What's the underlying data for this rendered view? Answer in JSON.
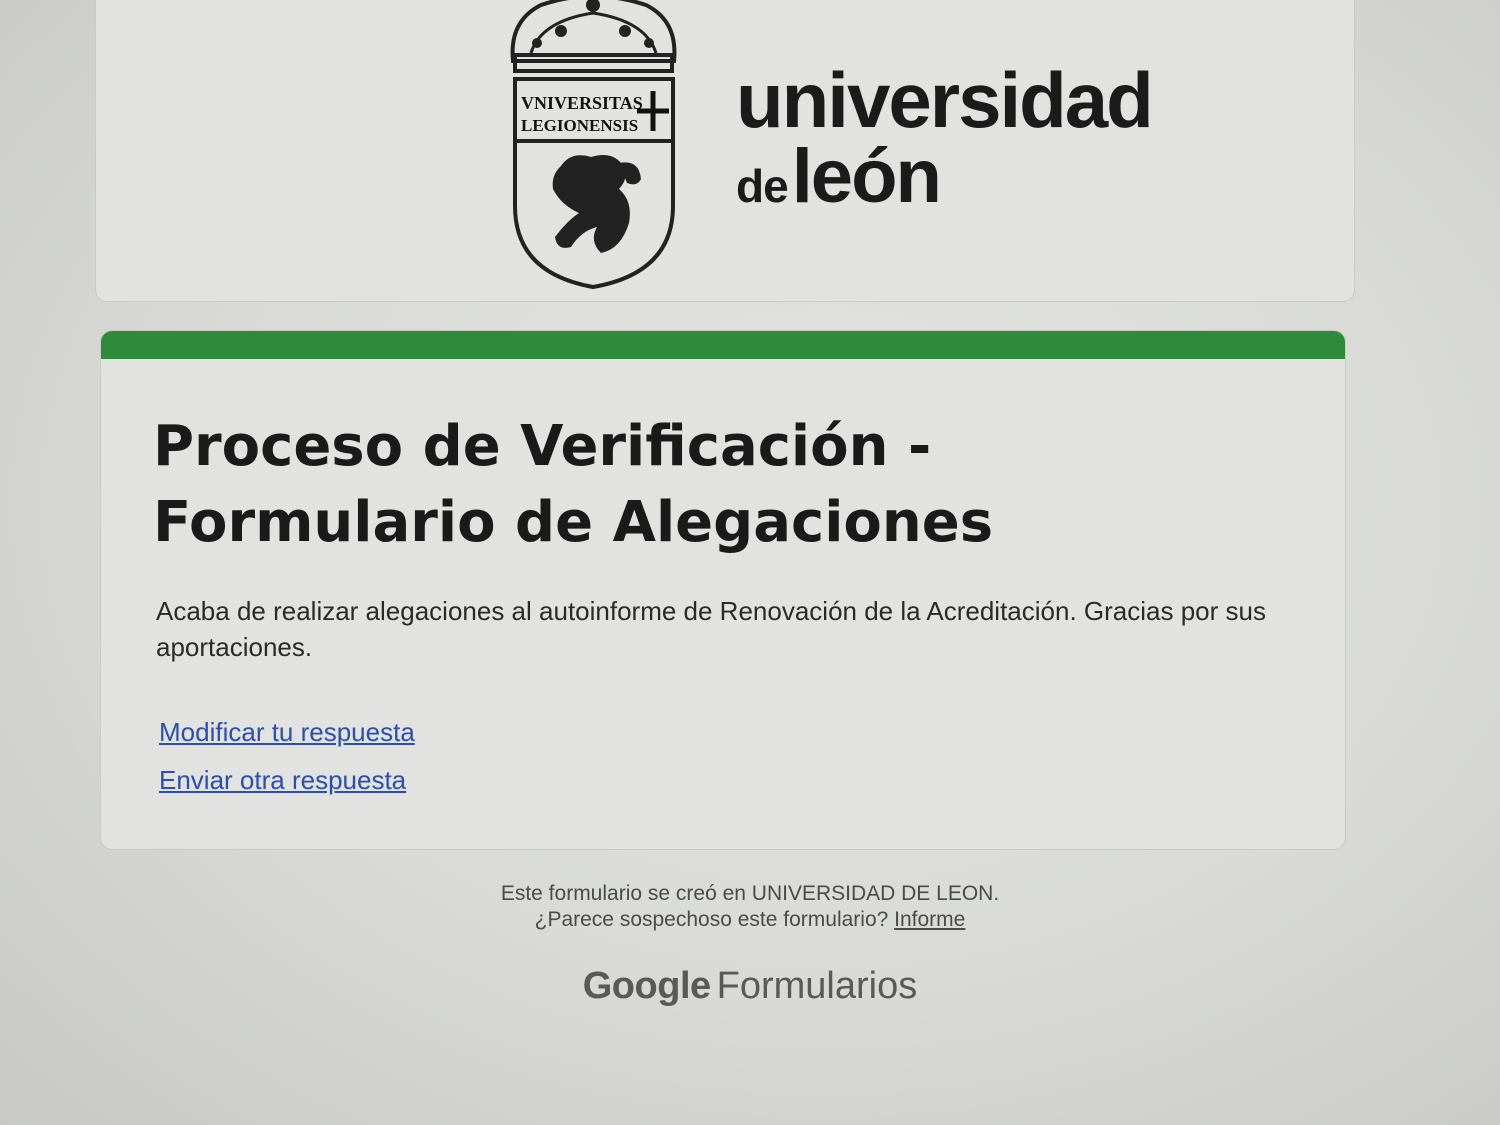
{
  "header": {
    "crest_motto_line1": "VNIVERSITAS",
    "crest_motto_line2": "LEGIONENSIS",
    "brand_line1": "universidad",
    "brand_line2_de": "de",
    "brand_line2_leon": "león"
  },
  "form": {
    "accent_color": "#2e8b3a",
    "title": "Proceso de Verificación - Formulario de Alegaciones",
    "description": "Acaba de realizar alegaciones al autoinforme de Renovación de la Acreditación. Gracias por sus aportaciones.",
    "links": {
      "edit_response": "Modificar tu respuesta",
      "submit_another": "Enviar otra respuesta"
    }
  },
  "footer": {
    "created_in": "Este formulario se creó en UNIVERSIDAD DE LEON.",
    "suspicious_question": "¿Parece sospechoso este formulario?",
    "report_link": "Informe",
    "google_word": "Google",
    "product_word": "Formularios"
  }
}
